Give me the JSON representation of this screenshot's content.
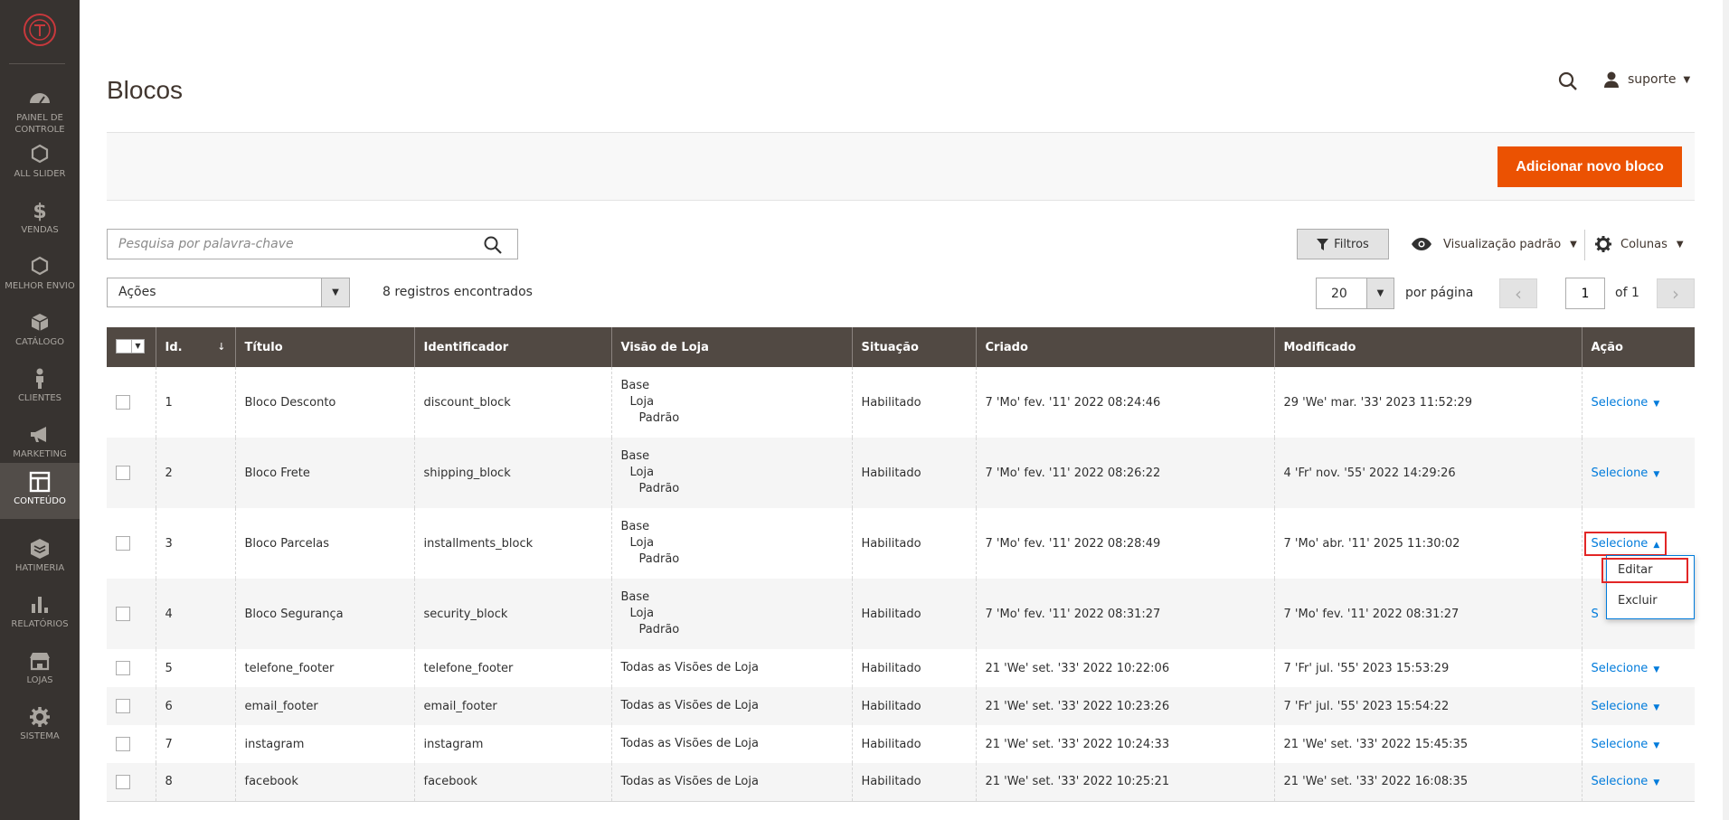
{
  "sidebar": {
    "items": [
      {
        "label": "PAINEL DE CONTROLE",
        "icon": "dashboard-icon"
      },
      {
        "label": "ALL SLIDER",
        "icon": "hexagon-icon"
      },
      {
        "label": "VENDAS",
        "icon": "dollar-icon"
      },
      {
        "label": "MELHOR ENVIO",
        "icon": "hexagon-icon"
      },
      {
        "label": "CATÁLOGO",
        "icon": "box-icon"
      },
      {
        "label": "CLIENTES",
        "icon": "person-icon"
      },
      {
        "label": "MARKETING",
        "icon": "megaphone-icon"
      },
      {
        "label": "CONTEÚDO",
        "icon": "layout-icon"
      },
      {
        "label": "HATIMERIA",
        "icon": "module-icon"
      },
      {
        "label": "RELATÓRIOS",
        "icon": "bar-chart-icon"
      },
      {
        "label": "LOJAS",
        "icon": "store-icon"
      },
      {
        "label": "SISTEMA",
        "icon": "gear-icon"
      }
    ],
    "active_index": 7
  },
  "header": {
    "title": "Blocos",
    "user": "suporte"
  },
  "action_bar": {
    "add_label": "Adicionar novo bloco"
  },
  "toolbar": {
    "search_placeholder": "Pesquisa por palavra-chave",
    "filters_label": "Filtros",
    "view_label": "Visualização padrão",
    "columns_label": "Colunas",
    "mass_actions_label": "Ações",
    "records_found": "8 registros encontrados",
    "page_size": "20",
    "per_page_label": "por página",
    "current_page": "1",
    "page_of": "of 1"
  },
  "grid": {
    "columns": [
      "Id.",
      "Título",
      "Identificador",
      "Visão de Loja",
      "Situação",
      "Criado",
      "Modificado",
      "Ação"
    ],
    "rows": [
      {
        "id": "1",
        "title": "Bloco Desconto",
        "identifier": "discount_block",
        "store": [
          "Base",
          "Loja",
          "Padrão"
        ],
        "status": "Habilitado",
        "created": "7 'Mo' fev. '11' 2022 08:24:46",
        "modified": "29 'We' mar. '33' 2023 11:52:29",
        "action": "Selecione"
      },
      {
        "id": "2",
        "title": "Bloco Frete",
        "identifier": "shipping_block",
        "store": [
          "Base",
          "Loja",
          "Padrão"
        ],
        "status": "Habilitado",
        "created": "7 'Mo' fev. '11' 2022 08:26:22",
        "modified": "4 'Fr' nov. '55' 2022 14:29:26",
        "action": "Selecione"
      },
      {
        "id": "3",
        "title": "Bloco Parcelas",
        "identifier": "installments_block",
        "store": [
          "Base",
          "Loja",
          "Padrão"
        ],
        "status": "Habilitado",
        "created": "7 'Mo' fev. '11' 2022 08:28:49",
        "modified": "7 'Mo' abr. '11' 2025 11:30:02",
        "action": "Selecione"
      },
      {
        "id": "4",
        "title": "Bloco Segurança",
        "identifier": "security_block",
        "store": [
          "Base",
          "Loja",
          "Padrão"
        ],
        "status": "Habilitado",
        "created": "7 'Mo' fev. '11' 2022 08:31:27",
        "modified": "7 'Mo' fev. '11' 2022 08:31:27",
        "action": "S"
      },
      {
        "id": "5",
        "title": "telefone_footer",
        "identifier": "telefone_footer",
        "store": [
          "Todas as Visões de Loja"
        ],
        "status": "Habilitado",
        "created": "21 'We' set. '33' 2022 10:22:06",
        "modified": "7 'Fr' jul. '55' 2023 15:53:29",
        "action": "Selecione"
      },
      {
        "id": "6",
        "title": "email_footer",
        "identifier": "email_footer",
        "store": [
          "Todas as Visões de Loja"
        ],
        "status": "Habilitado",
        "created": "21 'We' set. '33' 2022 10:23:26",
        "modified": "7 'Fr' jul. '55' 2023 15:54:22",
        "action": "Selecione"
      },
      {
        "id": "7",
        "title": "instagram",
        "identifier": "instagram",
        "store": [
          "Todas as Visões de Loja"
        ],
        "status": "Habilitado",
        "created": "21 'We' set. '33' 2022 10:24:33",
        "modified": "21 'We' set. '33' 2022 15:45:35",
        "action": "Selecione"
      },
      {
        "id": "8",
        "title": "facebook",
        "identifier": "facebook",
        "store": [
          "Todas as Visões de Loja"
        ],
        "status": "Habilitado",
        "created": "21 'We' set. '33' 2022 10:25:21",
        "modified": "21 'We' set. '33' 2022 16:08:35",
        "action": "Selecione"
      }
    ],
    "open_row_index": 2,
    "dropdown": {
      "items": [
        "Editar",
        "Excluir"
      ]
    }
  },
  "colors": {
    "sidebar_bg": "#373330",
    "header_bg": "#514943",
    "accent": "#eb5202",
    "link": "#007bdb",
    "highlight": "#e22626"
  }
}
